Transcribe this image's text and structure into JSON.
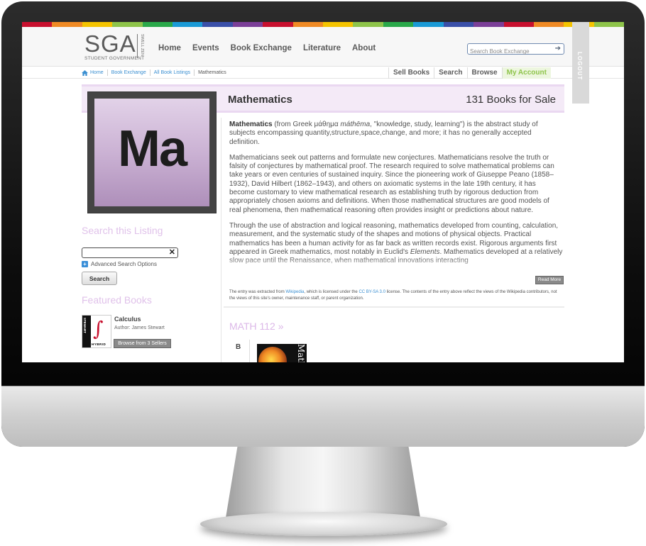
{
  "colors": {
    "strip": [
      "#c8102e",
      "#f08a24",
      "#f5c400",
      "#8ec44a",
      "#2aa84a",
      "#1a9ad6",
      "#3a4fa8",
      "#7b3f98",
      "#c8102e",
      "#f08a24",
      "#f5c400",
      "#8ec44a",
      "#2aa84a",
      "#1a9ad6",
      "#3a4fa8",
      "#7b3f98",
      "#c8102e",
      "#f08a24",
      "#f5c400",
      "#8ec44a"
    ],
    "accent": "#8ec44a",
    "heading_lilac": "#e0c2ea",
    "link_blue": "#3b8fd1"
  },
  "header": {
    "logo": {
      "text": "SGA",
      "sub": "STUDENT GOVERNMENT",
      "side": "SWELL ZEN"
    },
    "nav": [
      "Home",
      "Events",
      "Book Exchange",
      "Literature",
      "About"
    ],
    "search_placeholder": "Search Book Exchange",
    "search_icon": "arrow-right-icon",
    "logout_label": "LOGOUT"
  },
  "breadcrumb": {
    "home_icon": "home-icon",
    "items": [
      "Home",
      "Book Exchange",
      "All Book Listings"
    ],
    "current": "Mathematics"
  },
  "subnav": {
    "sell": "Sell Books",
    "search": "Search",
    "browse": "Browse",
    "account": "My Account"
  },
  "banner": {
    "title": "Mathematics",
    "count": "131 Books for Sale"
  },
  "subject_tile": {
    "letters": "Ma"
  },
  "sidebar": {
    "search_heading": "Search this Listing",
    "search_value": "",
    "clear_icon": "close-icon",
    "advanced_label": "Advanced Search Options",
    "search_button": "Search",
    "featured_heading": "Featured Books",
    "featured": {
      "cover_author": "STEWART",
      "cover_edition": "HYBRID",
      "title": "Calculus",
      "author": "Author: James Stewart",
      "button": "Browse from 3 Sellers"
    }
  },
  "article": {
    "p1_term": "Mathematics",
    "p1_a": " (from Greek μάθημα ",
    "p1_translit": "máthēma",
    "p1_b": ", \"knowledge, study, learning\") is the abstract study of subjects encompassing quantity,structure,space,change, and more; it has no generally accepted definition.",
    "p2": "Mathematicians seek out patterns and formulate new conjectures. Mathematicians resolve the truth or falsity of conjectures by mathematical proof. The research required to solve mathematical problems can take years or even centuries of sustained inquiry. Since the pioneering work of Giuseppe Peano (1858–1932), David Hilbert (1862–1943), and others on axiomatic systems in the late 19th century, it has become customary to view mathematical research as establishing truth by rigorous deduction from appropriately chosen axioms and definitions. When those mathematical structures are good models of real phenomena, then mathematical reasoning often provides insight or predictions about nature.",
    "p3_a": "Through the use of abstraction and logical reasoning, mathematics developed from counting, calculation, measurement, and the systematic study of the shapes and motions of physical objects. Practical mathematics has been a human activity for as far back as written records exist. Rigorous arguments first appeared in Greek mathematics, most notably in Euclid's ",
    "p3_em": "Elements",
    "p3_b": ". Mathematics developed at a relatively slow pace until the Renaissance, when mathematical innovations interacting",
    "read_more": "Read More",
    "attr_a": "The entry was extracted from ",
    "attr_link1": "Wikipedia",
    "attr_b": ", which is licensed under the ",
    "attr_link2": "CC BY-SA 3.0",
    "attr_c": " license. The contents of the entry above reflect the views of the Wikipedia contributors, not the views of this site's owner, maintenance staff, or parent organization."
  },
  "course": {
    "heading": "MATH 112 »",
    "letter": "B",
    "cover_text": "Math"
  }
}
